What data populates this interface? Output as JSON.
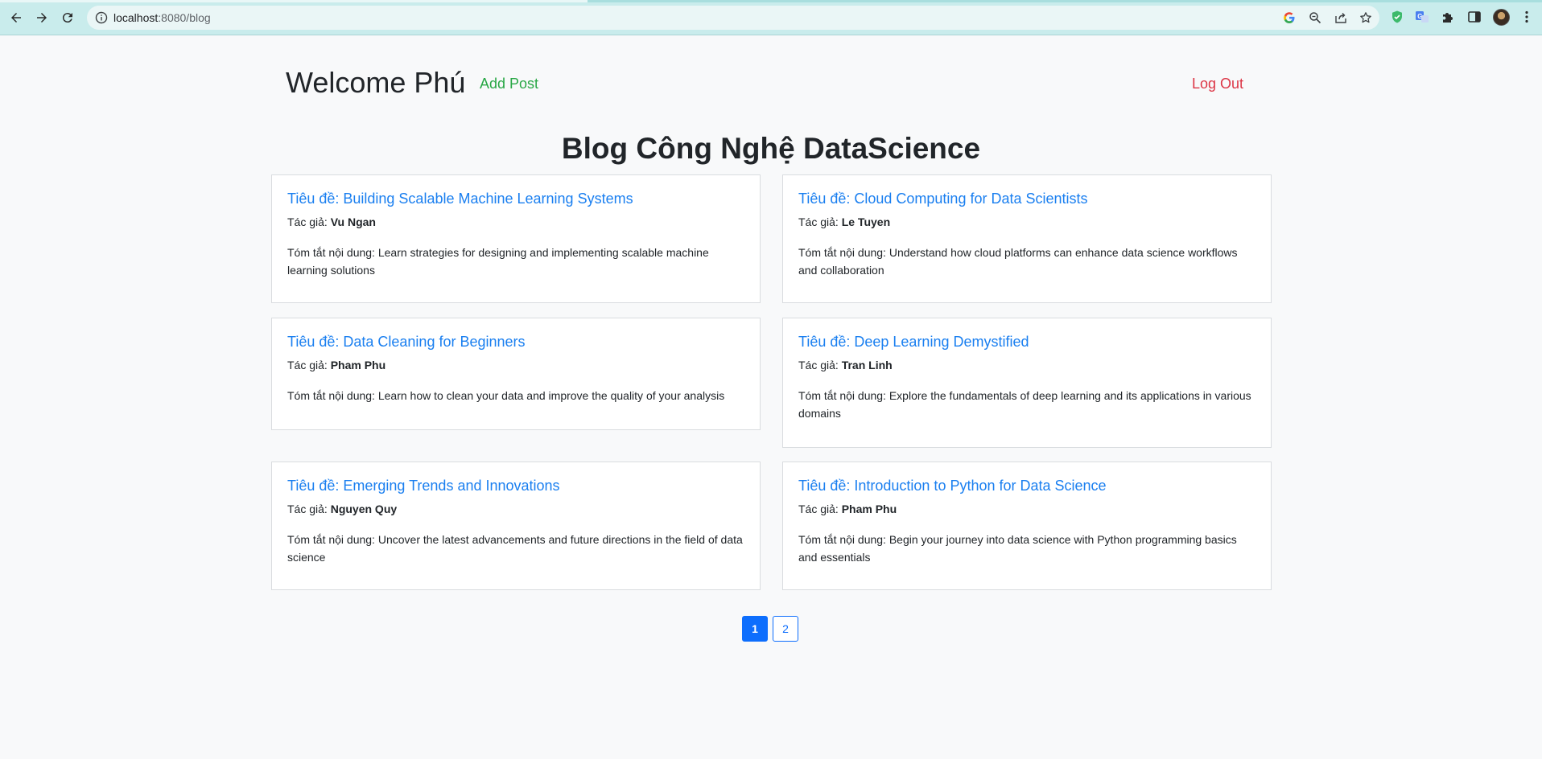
{
  "browser": {
    "url_host": "localhost",
    "url_rest": ":8080/blog"
  },
  "header": {
    "welcome": "Welcome Phú",
    "add_post": "Add Post",
    "logout": "Log Out"
  },
  "blog_title": "Blog Công Nghệ DataScience",
  "labels": {
    "title_prefix": "Tiêu đề: ",
    "author_prefix": "Tác giả: ",
    "summary_prefix": "Tóm tắt nội dung: "
  },
  "posts": [
    {
      "title": "Building Scalable Machine Learning Systems",
      "author": "Vu Ngan",
      "summary": "Learn strategies for designing and implementing scalable machine learning solutions"
    },
    {
      "title": "Cloud Computing for Data Scientists",
      "author": "Le Tuyen",
      "summary": "Understand how cloud platforms can enhance data science workflows and collaboration"
    },
    {
      "title": "Data Cleaning for Beginners",
      "author": "Pham Phu",
      "summary": "Learn how to clean your data and improve the quality of your analysis"
    },
    {
      "title": "Deep Learning Demystified",
      "author": "Tran Linh",
      "summary": "Explore the fundamentals of deep learning and its applications in various domains"
    },
    {
      "title": "Emerging Trends and Innovations",
      "author": "Nguyen Quy",
      "summary": "Uncover the latest advancements and future directions in the field of data science"
    },
    {
      "title": "Introduction to Python for Data Science",
      "author": "Pham Phu",
      "summary": "Begin your journey into data science with Python programming basics and essentials"
    }
  ],
  "pagination": {
    "pages": [
      "1",
      "2"
    ],
    "current": "1"
  },
  "colors": {
    "link": "#1a7ff0",
    "add_post": "#28a745",
    "logout": "#dc3545",
    "page_active": "#0d6efd"
  }
}
